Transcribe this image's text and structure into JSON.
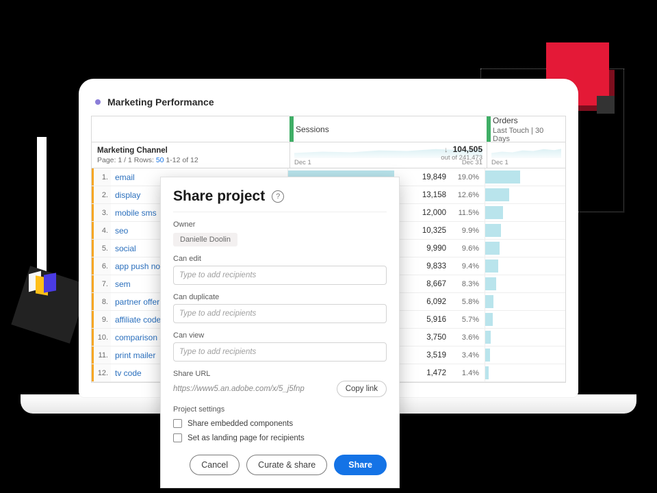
{
  "panel": {
    "title": "Marketing Performance"
  },
  "columns": {
    "dimension_label": "Marketing Channel",
    "pager_prefix": "Page: 1 / 1  Rows:",
    "pager_rows": "50",
    "pager_range": "1-12 of 12",
    "sessions_label": "Sessions",
    "orders_label": "Orders",
    "orders_sub": "Last Touch | 30 Days",
    "sessions_total": "104,505",
    "sessions_out_of": "out of 241,473",
    "date_start": "Dec 1",
    "date_end": "Dec 31"
  },
  "rows": [
    {
      "idx": "1.",
      "name": "email",
      "sessions_val": "19,849",
      "sessions_pct": "19.0%",
      "bar_sess": 54,
      "bar_ord": 44
    },
    {
      "idx": "2.",
      "name": "display",
      "sessions_val": "13,158",
      "sessions_pct": "12.6%",
      "bar_sess": 38,
      "bar_ord": 30
    },
    {
      "idx": "3.",
      "name": "mobile sms",
      "sessions_val": "12,000",
      "sessions_pct": "11.5%",
      "bar_sess": 34,
      "bar_ord": 22
    },
    {
      "idx": "4.",
      "name": "seo",
      "sessions_val": "10,325",
      "sessions_pct": "9.9%",
      "bar_sess": 30,
      "bar_ord": 20
    },
    {
      "idx": "5.",
      "name": "social",
      "sessions_val": "9,990",
      "sessions_pct": "9.6%",
      "bar_sess": 29,
      "bar_ord": 18
    },
    {
      "idx": "6.",
      "name": "app push notification",
      "sessions_val": "9,833",
      "sessions_pct": "9.4%",
      "bar_sess": 28,
      "bar_ord": 16
    },
    {
      "idx": "7.",
      "name": "sem",
      "sessions_val": "8,667",
      "sessions_pct": "8.3%",
      "bar_sess": 25,
      "bar_ord": 14
    },
    {
      "idx": "8.",
      "name": "partner offer",
      "sessions_val": "6,092",
      "sessions_pct": "5.8%",
      "bar_sess": 18,
      "bar_ord": 10
    },
    {
      "idx": "9.",
      "name": "affiliate code",
      "sessions_val": "5,916",
      "sessions_pct": "5.7%",
      "bar_sess": 17,
      "bar_ord": 9
    },
    {
      "idx": "10.",
      "name": "comparison shopping",
      "sessions_val": "3,750",
      "sessions_pct": "3.6%",
      "bar_sess": 12,
      "bar_ord": 7
    },
    {
      "idx": "11.",
      "name": "print mailer",
      "sessions_val": "3,519",
      "sessions_pct": "3.4%",
      "bar_sess": 11,
      "bar_ord": 6
    },
    {
      "idx": "12.",
      "name": "tv code",
      "sessions_val": "1,472",
      "sessions_pct": "1.4%",
      "bar_sess": 5,
      "bar_ord": 4
    }
  ],
  "modal": {
    "title": "Share project",
    "owner_label": "Owner",
    "owner_name": "Danielle Doolin",
    "can_edit_label": "Can edit",
    "can_duplicate_label": "Can duplicate",
    "can_view_label": "Can view",
    "recipients_placeholder": "Type to add recipients",
    "share_url_label": "Share URL",
    "share_url": "https://www5.an.adobe.com/x/5_j5fnp",
    "copy_link": "Copy link",
    "project_settings_label": "Project settings",
    "chk1": "Share embedded components",
    "chk2": "Set as landing page for recipients",
    "cancel": "Cancel",
    "curate": "Curate & share",
    "share": "Share"
  }
}
